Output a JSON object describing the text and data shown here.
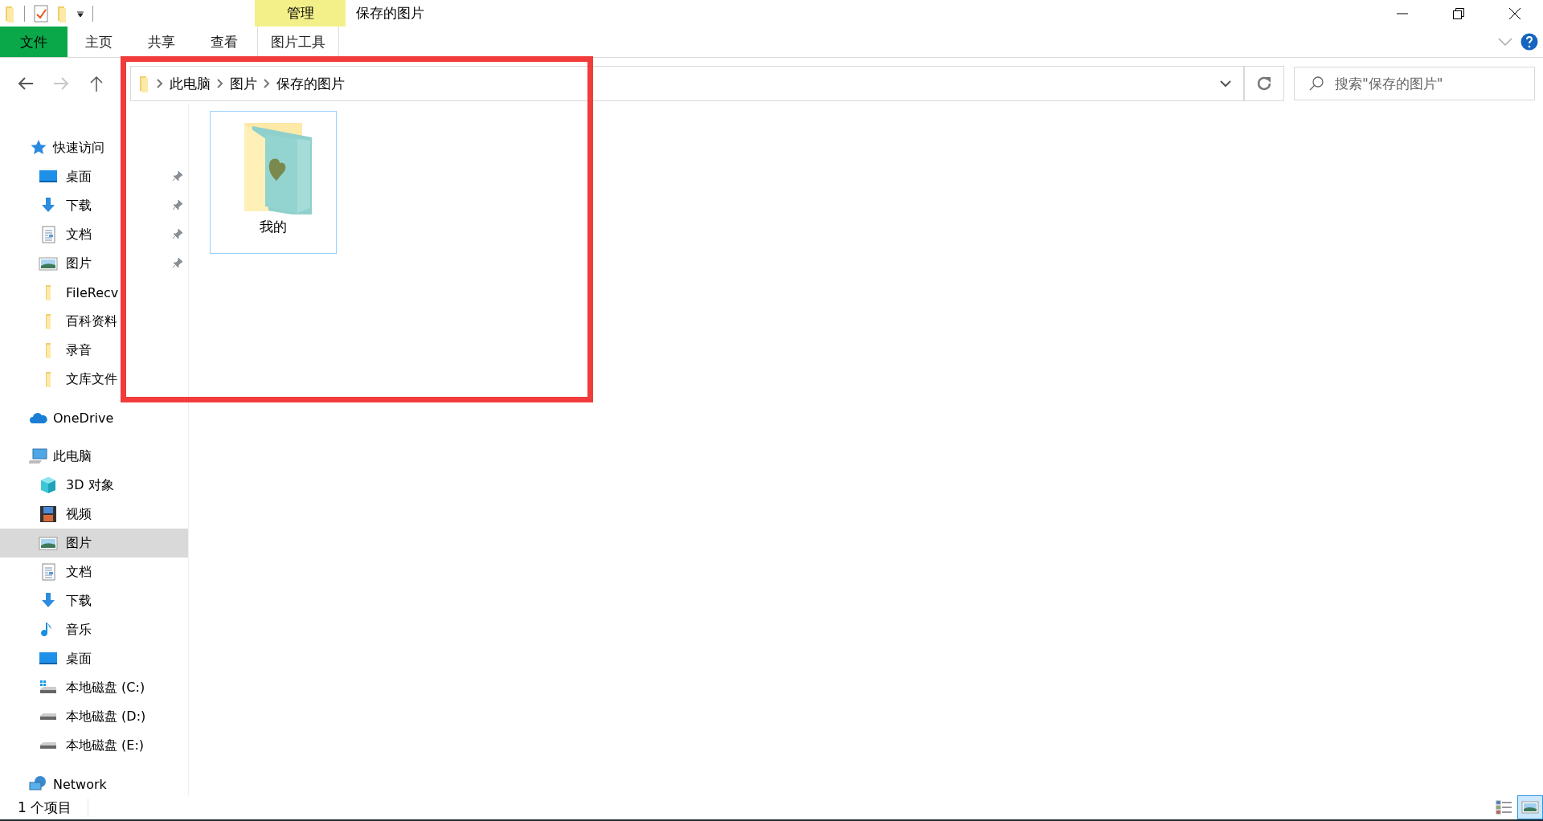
{
  "window": {
    "title": "保存的图片"
  },
  "ribbon": {
    "file_tab": "文件",
    "tabs": [
      {
        "label": "主页",
        "selected": false
      },
      {
        "label": "共享",
        "selected": false
      },
      {
        "label": "查看",
        "selected": false
      }
    ],
    "context": {
      "header": "管理",
      "tab": {
        "label": "图片工具",
        "selected": false
      }
    }
  },
  "address": {
    "path": [
      "此电脑",
      "图片",
      "保存的图片"
    ]
  },
  "search": {
    "placeholder": "搜索\"保存的图片\""
  },
  "sidebar": [
    {
      "label": "快速访问",
      "kind": "star",
      "selected": false,
      "children": [
        {
          "label": "桌面",
          "kind": "desktop",
          "pinned": true,
          "selected": false
        },
        {
          "label": "下载",
          "kind": "download",
          "pinned": true,
          "selected": false
        },
        {
          "label": "文档",
          "kind": "document",
          "pinned": true,
          "selected": false
        },
        {
          "label": "图片",
          "kind": "pictures",
          "pinned": true,
          "selected": false
        },
        {
          "label": "FileRecv",
          "kind": "folder",
          "pinned": false,
          "selected": false
        },
        {
          "label": "百科资料",
          "kind": "folder",
          "pinned": false,
          "selected": false
        },
        {
          "label": "录音",
          "kind": "folder",
          "pinned": false,
          "selected": false
        },
        {
          "label": "文库文件",
          "kind": "folder",
          "pinned": false,
          "selected": false
        }
      ]
    },
    {
      "label": "OneDrive",
      "kind": "cloud",
      "selected": false
    },
    {
      "label": "此电脑",
      "kind": "computer",
      "selected": false,
      "children": [
        {
          "label": "3D 对象",
          "kind": "cube",
          "selected": false
        },
        {
          "label": "视频",
          "kind": "video",
          "selected": false
        },
        {
          "label": "图片",
          "kind": "pictures",
          "selected": true
        },
        {
          "label": "文档",
          "kind": "document",
          "selected": false
        },
        {
          "label": "下载",
          "kind": "download",
          "selected": false
        },
        {
          "label": "音乐",
          "kind": "music",
          "selected": false
        },
        {
          "label": "桌面",
          "kind": "desktop",
          "selected": false
        },
        {
          "label": "本地磁盘 (C:)",
          "kind": "system-drive",
          "selected": false
        },
        {
          "label": "本地磁盘 (D:)",
          "kind": "drive",
          "selected": false
        },
        {
          "label": "本地磁盘 (E:)",
          "kind": "drive",
          "selected": false
        }
      ]
    },
    {
      "label": "Network",
      "kind": "network",
      "selected": false
    }
  ],
  "items": [
    {
      "name": "我的",
      "focused": true
    }
  ],
  "status_bar": {
    "count": "1 个项目",
    "views": [
      {
        "kind": "details",
        "selected": false
      },
      {
        "kind": "large-icons",
        "selected": true
      }
    ]
  }
}
